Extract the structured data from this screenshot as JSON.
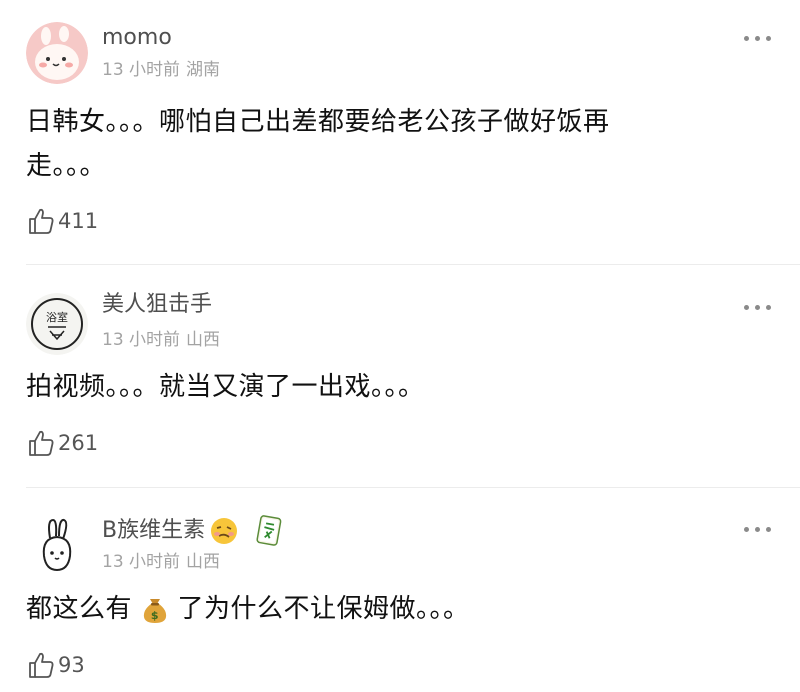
{
  "comments": [
    {
      "username": "momo",
      "time": "13 小时前",
      "location": "湖南",
      "text_lines": [
        "日韩女。。。哪怕自己出差都要给老公孩子做好饭再",
        "走。。。"
      ],
      "likes": "411",
      "avatar_icon": "pink-bunny-avatar"
    },
    {
      "username": "美人狙击手",
      "time": "13 小时前",
      "location": "山西",
      "text": "拍视频。。。就当又演了一出戏。。。",
      "likes": "261",
      "avatar_icon": "stamp-seal-avatar",
      "avatar_seal_text": "浴室"
    },
    {
      "username": "B族维生素",
      "username_emojis": [
        "woozy-face-emoji",
        "mahjong-fa-tile-emoji"
      ],
      "time": "13 小时前",
      "location": "山西",
      "text_before": "都这么有",
      "text_icon": "money-bag-emoji",
      "text_after": "了为什么不让保姆做。。。",
      "likes": "93",
      "avatar_icon": "doodle-bunny-avatar"
    }
  ],
  "colors": {
    "username": "#4f4f4f",
    "meta": "#a3a3a3",
    "text": "#111111",
    "divider": "#ececec"
  }
}
